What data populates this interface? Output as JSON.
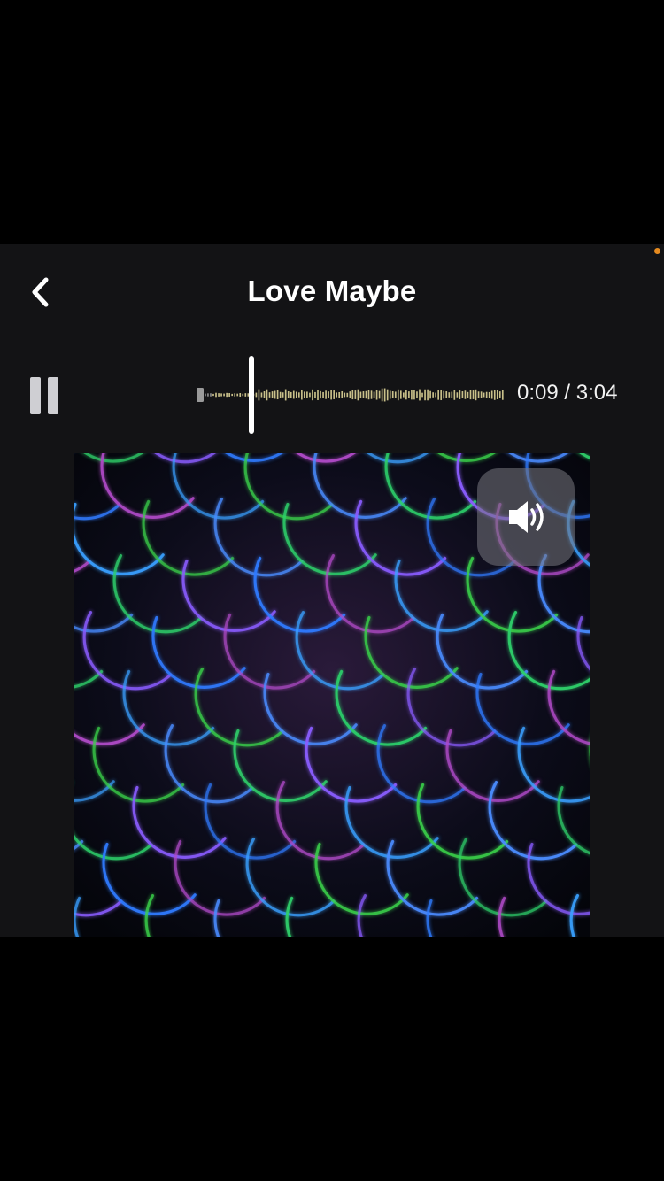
{
  "header": {
    "title": "Love Maybe",
    "back_icon": "chevron-left-icon"
  },
  "player": {
    "pause_icon": "pause-icon",
    "current_time": "0:09",
    "duration": "3:04",
    "time_display": "0:09 / 3:04",
    "progress_fraction": 0.049,
    "waveform_color": "#c9c08a",
    "played_color": "#8d8d8d",
    "playhead_color": "#ffffff"
  },
  "artwork": {
    "volume_icon": "speaker-volume-icon"
  },
  "colors": {
    "background": "#131315",
    "accent_dot": "#e58a1f"
  }
}
